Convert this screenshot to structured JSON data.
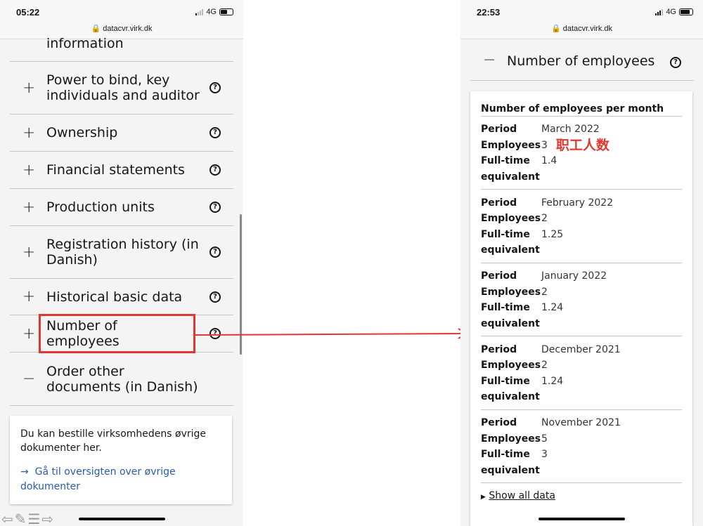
{
  "left_phone": {
    "status": {
      "time": "05:22",
      "network": "4G",
      "url": "datacvr.virk.dk"
    },
    "items": [
      {
        "label": "information",
        "icon": "plus"
      },
      {
        "label": "Power to bind, key individuals and auditor",
        "icon": "plus"
      },
      {
        "label": "Ownership",
        "icon": "plus"
      },
      {
        "label": "Financial statements",
        "icon": "plus"
      },
      {
        "label": "Production units",
        "icon": "plus"
      },
      {
        "label": "Registration history (in Danish)",
        "icon": "plus"
      },
      {
        "label": "Historical basic data",
        "icon": "plus"
      },
      {
        "label": "Number of employees",
        "icon": "plus",
        "highlighted": true
      },
      {
        "label": "Order other documents (in Danish)",
        "icon": "minus"
      }
    ],
    "plus": "+",
    "minus": "−",
    "help": "?",
    "card": {
      "text": "Du kan bestille virksomhedens øvrige dokumenter her.",
      "link": "Gå til oversigten over øvrige dokumenter",
      "arrow": "→"
    },
    "highlight_color": "#e0382e"
  },
  "right_phone": {
    "status": {
      "time": "22:53",
      "network": "4G",
      "url": "datacvr.virk.dk"
    },
    "section_title": "Number of employees",
    "minus": "−",
    "help": "?",
    "table_title": "Number of employees per month",
    "labels": {
      "period": "Period",
      "employees": "Employees",
      "fte1": "Full-time",
      "fte2": "equivalent"
    },
    "records": [
      {
        "period": "March 2022",
        "employees": "3",
        "fte": "1.4"
      },
      {
        "period": "February 2022",
        "employees": "2",
        "fte": "1.25"
      },
      {
        "period": "January 2022",
        "employees": "2",
        "fte": "1.24"
      },
      {
        "period": "December 2021",
        "employees": "2",
        "fte": "1.24"
      },
      {
        "period": "November 2021",
        "employees": "5",
        "fte": "3"
      }
    ],
    "annotation": "职工人数",
    "show_all": "Show all data",
    "triangle": "▶"
  }
}
